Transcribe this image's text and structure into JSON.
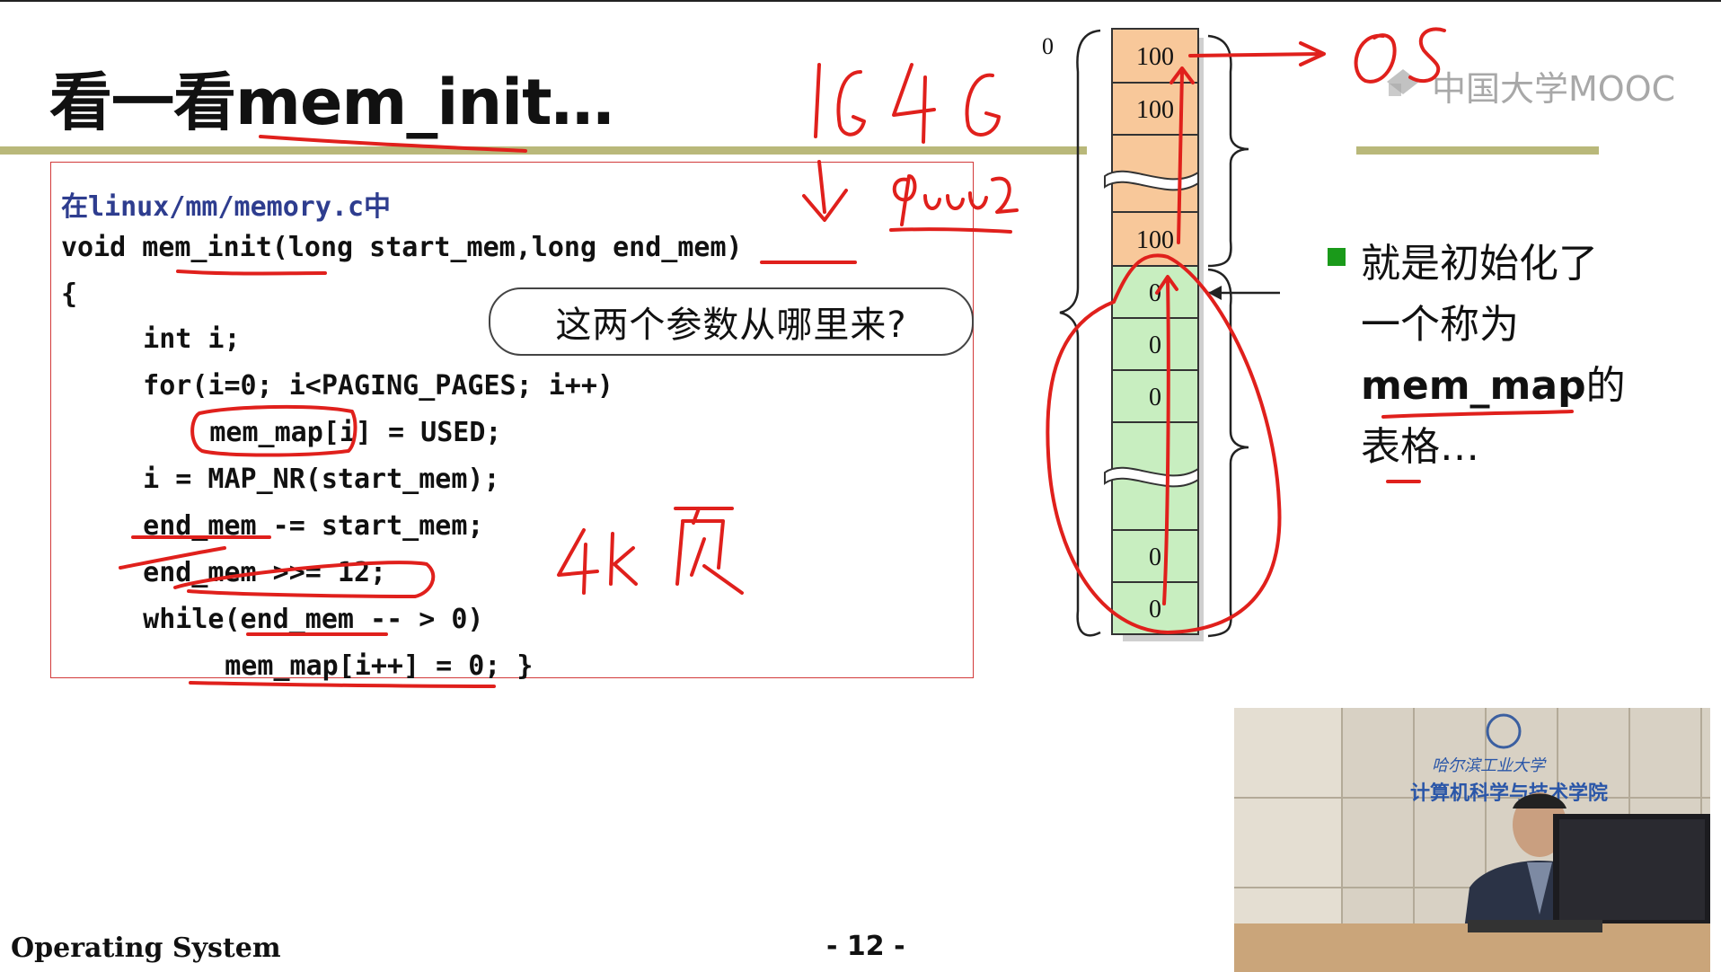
{
  "slide": {
    "title": "看一看mem_init…",
    "watermark": "中国大学MOOC",
    "footer_left": "Operating System",
    "page_number": "- 12 -"
  },
  "code": {
    "path_line": "在linux/mm/memory.c中",
    "lines": [
      "void mem_init(long start_mem,long end_mem)",
      "{",
      "   int i;",
      "   for(i=0; i<PAGING_PAGES; i++)",
      "      mem_map[i] = USED;",
      "   i = MAP_NR(start_mem);",
      "   end_mem -= start_mem;",
      "   end_mem >>= 12;",
      "   while(end_mem -- > 0)",
      "     mem_map[i++] = 0; }"
    ]
  },
  "callout": "这两个参数从哪里来?",
  "memory_table": {
    "origin_label": "0",
    "cells": [
      "100",
      "100",
      "",
      "100",
      "0",
      "0",
      "0",
      "",
      "0",
      "0"
    ],
    "colors": {
      "used": "#f8c89a",
      "free": "#c8eec0"
    }
  },
  "bullet": {
    "text_before": "就是初始化了一个称为",
    "bold": "mem_map",
    "text_after": "的表格…"
  },
  "annotations": {
    "handwritten": [
      "1G",
      "4G",
      "4K",
      "页",
      "OS",
      "9000 2"
    ],
    "color": "#e0201c"
  },
  "video": {
    "sign_line1": "哈尔滨工业大学",
    "sign_line2": "计算机科学与技术学院"
  }
}
